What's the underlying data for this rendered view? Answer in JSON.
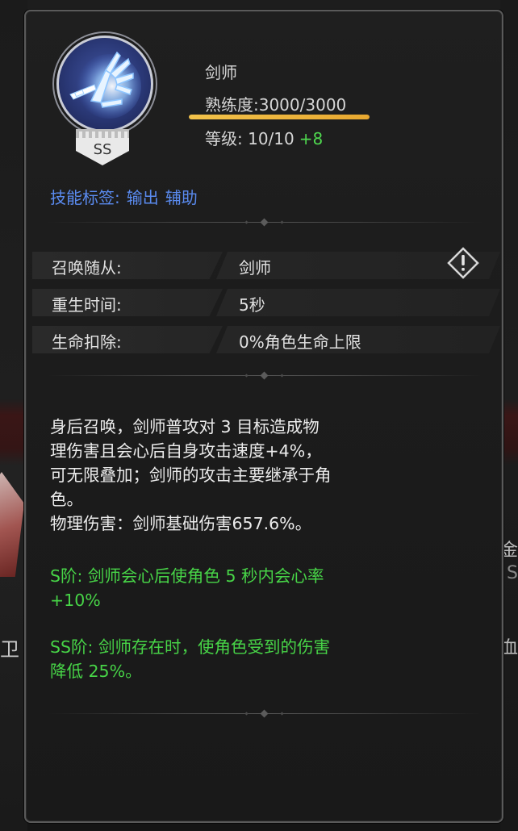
{
  "skill": {
    "name": "剑师",
    "proficiency_text": "熟练度:3000/3000",
    "proficiency_current": 3000,
    "proficiency_max": 3000,
    "level_text": "等级: 10/10",
    "level_bonus": "+8",
    "rank": "SS",
    "icon": "sword-slash-icon"
  },
  "tags": {
    "label": "技能标签:",
    "items": [
      "输出",
      "辅助"
    ]
  },
  "attributes": [
    {
      "label": "召唤随从:",
      "value": "剑师"
    },
    {
      "label": "重生时间:",
      "value": "5秒"
    },
    {
      "label": "生命扣除:",
      "value": "0%角色生命上限"
    }
  ],
  "description": {
    "lines": [
      "身后召唤，剑师普攻对 3 目标造成物",
      "理伤害且会心后自身攻击速度+4%，",
      "可无限叠加；剑师的攻击主要继承于角",
      "色。",
      "物理伤害：剑师基础伤害657.6%。"
    ]
  },
  "tiers": [
    {
      "lines": [
        "S阶: 剑师会心后使角色 5 秒内会心率",
        "+10%"
      ]
    },
    {
      "lines": [
        "SS阶: 剑师存在时，使角色受到的伤害",
        "降低 25%。"
      ]
    }
  ],
  "background": {
    "left_glyph": "卫",
    "right_glyphs": [
      "金",
      "S",
      "血"
    ]
  },
  "colors": {
    "tag_blue": "#5a8bf0",
    "tier_green": "#47d447",
    "bonus_green": "#4fd84f",
    "progress_gold": "#f2c24a"
  }
}
